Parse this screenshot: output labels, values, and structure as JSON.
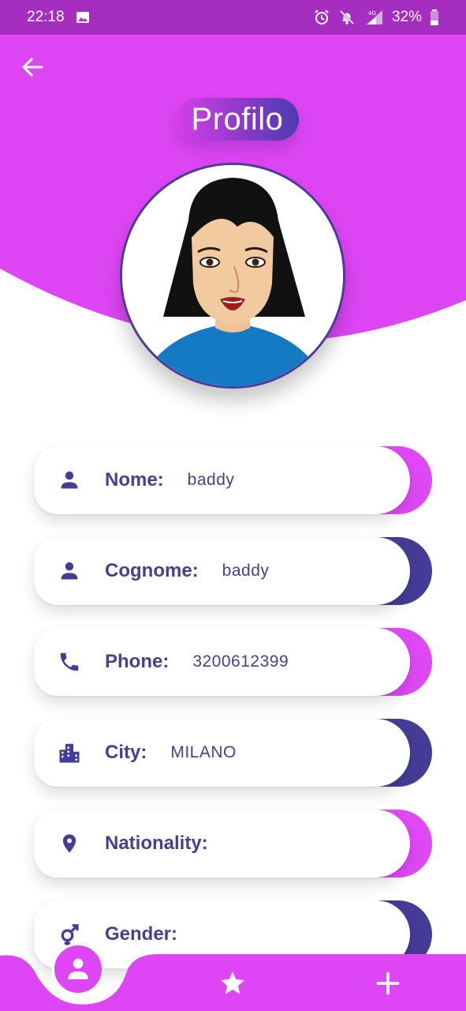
{
  "status_bar": {
    "time": "22:18",
    "network": "4G",
    "battery": "32%",
    "icons": [
      "image-icon",
      "alarm-icon",
      "bell-off-icon",
      "signal-icon",
      "battery-icon"
    ]
  },
  "header": {
    "title": "Profilo",
    "back_icon": "arrow-left-icon"
  },
  "colors": {
    "status_bar": "#a52ec0",
    "header": "#de45f5",
    "accent_magenta": "#e048f6",
    "accent_indigo": "#463c98",
    "text_dark": "#45418c"
  },
  "profile_fields": [
    {
      "icon": "person-icon",
      "label": "Nome:",
      "value": "baddy",
      "accent": "#e048f6"
    },
    {
      "icon": "person-icon",
      "label": "Cognome:",
      "value": "baddy",
      "accent": "#463c98"
    },
    {
      "icon": "phone-icon",
      "label": "Phone:",
      "value": "3200612399",
      "accent": "#e048f6"
    },
    {
      "icon": "city-icon",
      "label": "City:",
      "value": "MILANO",
      "accent": "#463c98"
    },
    {
      "icon": "location-pin-icon",
      "label": "Nationality:",
      "value": "",
      "accent": "#e048f6"
    },
    {
      "icon": "gender-icon",
      "label": "Gender:",
      "value": "",
      "accent": "#463c98"
    }
  ],
  "bottom_nav": {
    "items": [
      {
        "icon": "person-icon",
        "active": true
      },
      {
        "icon": "star-icon",
        "active": false
      },
      {
        "icon": "plus-icon",
        "active": false
      }
    ]
  }
}
